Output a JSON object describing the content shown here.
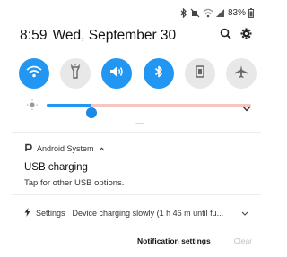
{
  "status": {
    "battery": "83%",
    "icons": [
      "bluetooth-icon",
      "silent-icon",
      "wifi-icon",
      "signal-icon",
      "battery-icon"
    ]
  },
  "header": {
    "time": "8:59",
    "date": "Wed, September 30",
    "actions": [
      "search-icon",
      "gear-icon"
    ]
  },
  "quick_settings": [
    {
      "name": "wifi",
      "icon": "wifi-icon",
      "on": true
    },
    {
      "name": "flashlight",
      "icon": "flashlight-icon",
      "on": false
    },
    {
      "name": "sound",
      "icon": "volume-icon",
      "on": true
    },
    {
      "name": "bluetooth",
      "icon": "bluetooth-icon",
      "on": true
    },
    {
      "name": "portrait",
      "icon": "portrait-icon",
      "on": false
    },
    {
      "name": "airplane",
      "icon": "airplane-icon",
      "on": false
    }
  ],
  "brightness": {
    "level": 0.22
  },
  "notifications": [
    {
      "app": "Android System",
      "title": "USB charging",
      "text": "Tap for other USB options."
    },
    {
      "app": "Settings",
      "text": "Device charging slowly (1 h 46 m until fu..."
    }
  ],
  "footer": {
    "settings_label": "Notification settings",
    "clear_label": "Clear"
  },
  "colors": {
    "accent": "#2196f3",
    "tile_off": "#e8e8e8"
  }
}
